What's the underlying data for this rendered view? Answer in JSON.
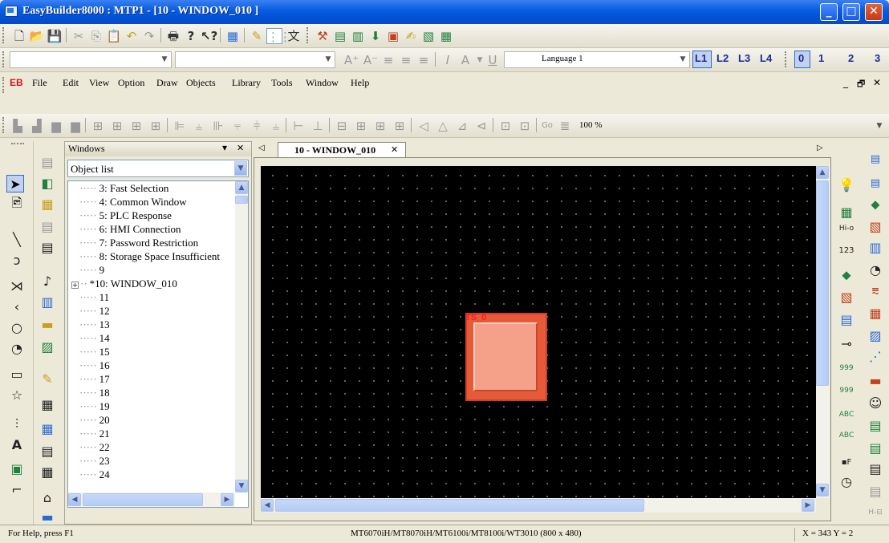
{
  "window": {
    "title": "EasyBuilder8000 : MTP1 - [10 - WINDOW_010 ]",
    "minimize_glyph": "_",
    "maximize_glyph": "□",
    "close_glyph": "✕"
  },
  "format_toolbar": {
    "language_value": "Language 1",
    "layers": [
      "L1",
      "L2",
      "L3",
      "L4"
    ],
    "states": [
      "0",
      "1",
      "2",
      "3"
    ]
  },
  "menu": {
    "logo": "EB",
    "items": [
      "File",
      "Edit",
      "View",
      "Option",
      "Draw",
      "Objects",
      "Library",
      "Tools",
      "Window",
      "Help"
    ],
    "mdi_min": "_",
    "mdi_restore": "🗗",
    "mdi_close": "✕"
  },
  "align_toolbar": {
    "zoom_value": "100 %"
  },
  "windows_panel": {
    "header": "Windows",
    "pin_glyph": "▾",
    "close_glyph": "✕",
    "combo_value": "Object list",
    "tree": [
      "3: Fast Selection",
      "4: Common Window",
      "5: PLC Response",
      "6: HMI Connection",
      "7: Password Restriction",
      "8: Storage Space Insufficient",
      "9",
      "*10: WINDOW_010",
      "11",
      "12",
      "13",
      "14",
      "15",
      "16",
      "17",
      "18",
      "19",
      "20",
      "21",
      "22",
      "23",
      "24"
    ],
    "expand_glyph": "+"
  },
  "editor": {
    "tab_label": "10 - WINDOW_010",
    "tab_close": "✕",
    "nav_prev": "◁",
    "nav_next": "▷",
    "object_label": "TS_0",
    "colors": {
      "canvas": "#000000",
      "object_outer": "#e65a3a",
      "object_inner": "#f5a18a",
      "object_label": "#ff1a1a"
    }
  },
  "statusbar": {
    "help_text": "For Help, press F1",
    "model_text": "MT6070iH/MT8070iH/MT6100i/MT8100i/WT3010 (800 x 480)",
    "coords_text": "X = 343  Y = 2"
  },
  "icons": {
    "file_toolbar": [
      "new-icon",
      "open-icon",
      "save-icon",
      "cut-icon",
      "copy-icon",
      "paste-icon",
      "undo-icon",
      "redo-icon",
      "print-icon",
      "help-icon",
      "context-help-icon",
      "project-manager-icon",
      "pen-icon",
      "grid-icon",
      "font-icon",
      "tools-icon",
      "compile-icon",
      "simulate-icon",
      "download-icon",
      "text-db-icon",
      "address-icon",
      "picture-icon",
      "table-icon"
    ],
    "draw_tools": [
      "select-icon",
      "properties-icon",
      "line-icon",
      "polyline-icon",
      "polygon-icon",
      "arc-icon",
      "circle-icon",
      "pie-icon",
      "rectangle-icon",
      "star-icon",
      "scale-icon",
      "text-icon",
      "picture-icon",
      "dimension-icon"
    ]
  }
}
